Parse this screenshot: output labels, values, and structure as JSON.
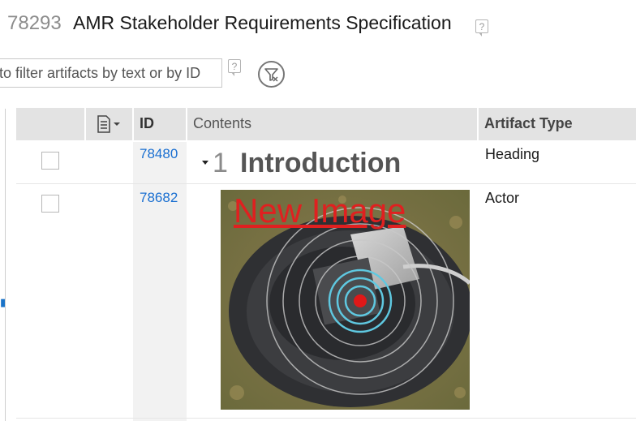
{
  "header": {
    "doc_id": "78293",
    "title": "AMR Stakeholder Requirements Specification",
    "help_glyph": "?"
  },
  "filter": {
    "placeholder": "to filter artifacts by text or by ID",
    "help_glyph": "?"
  },
  "table": {
    "columns": {
      "menu_icon": "document-menu-icon",
      "id": "ID",
      "contents": "Contents",
      "artifact_type": "Artifact Type"
    },
    "rows": [
      {
        "id": "78480",
        "heading_number": "1",
        "heading_text": "Introduction",
        "type": "Heading"
      },
      {
        "id": "78682",
        "image_caption": "New Image",
        "type": "Actor"
      }
    ]
  },
  "colors": {
    "link": "#1a6fd1",
    "header_bg": "#e3e3e3",
    "caption_red": "#e02020"
  }
}
